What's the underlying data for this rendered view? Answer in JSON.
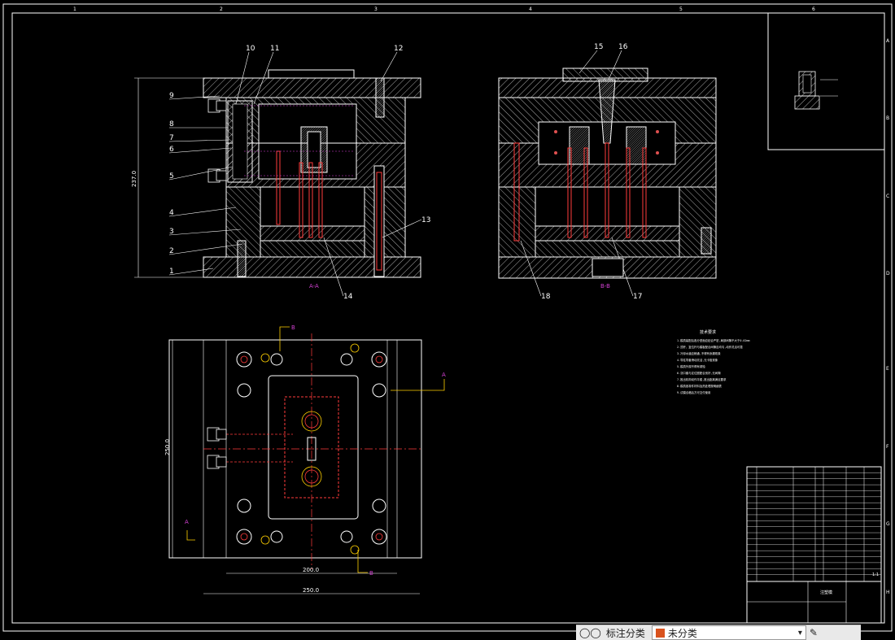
{
  "border": {
    "top_zones": [
      "1",
      "2",
      "3",
      "4",
      "5",
      "6"
    ],
    "right_zones": [
      "A",
      "B",
      "C",
      "D",
      "E",
      "F",
      "G",
      "H"
    ]
  },
  "views": {
    "section_a": {
      "label": "A-A",
      "height_dim": "237.0"
    },
    "section_b": {
      "label": "B-B"
    },
    "plan": {
      "width_inner_dim": "200.0",
      "width_outer_dim": "250.0",
      "height_dim": "250.0",
      "section_marks": [
        "A",
        "A",
        "B",
        "B"
      ]
    }
  },
  "part_numbers": {
    "left": [
      "9",
      "8",
      "7",
      "6",
      "5",
      "4",
      "3",
      "2",
      "1"
    ],
    "top": [
      "10",
      "11",
      "12",
      "15",
      "16"
    ],
    "other": [
      "13",
      "14",
      "18",
      "17"
    ]
  },
  "notes": {
    "title": "技术要求",
    "lines": [
      "1.模具装配后各分型面应贴合严密,局部间隙不大于0.02mm",
      "2.顶杆、复位杆与模板配合间隙应均匀,动作灵活可靠",
      "3.冷却水道应畅通,不得有渗漏现象",
      "4.导柱导套滑动灵活,无卡阻现象",
      "5.模具外观不得有锈蚀",
      "6.浇口套与定位圈配合良好,无间隙",
      "7.推出机构动作平稳,推出距离满足要求",
      "8.模具各零件材料及热处理按明细表",
      "9.试模合格后方可交付使用"
    ]
  },
  "title_block": {
    "name": "注塑模",
    "scale": "1:1",
    "weight": "",
    "bom_rows": 19
  },
  "toolbar": {
    "label1": "标注分类",
    "dropdown": "未分类"
  },
  "colors": {
    "lines": "#ffffff",
    "cut": "#ff3b3b",
    "hatch": "#cfcfcf",
    "dim": "#e040e0",
    "yellow": "#ffd000"
  }
}
